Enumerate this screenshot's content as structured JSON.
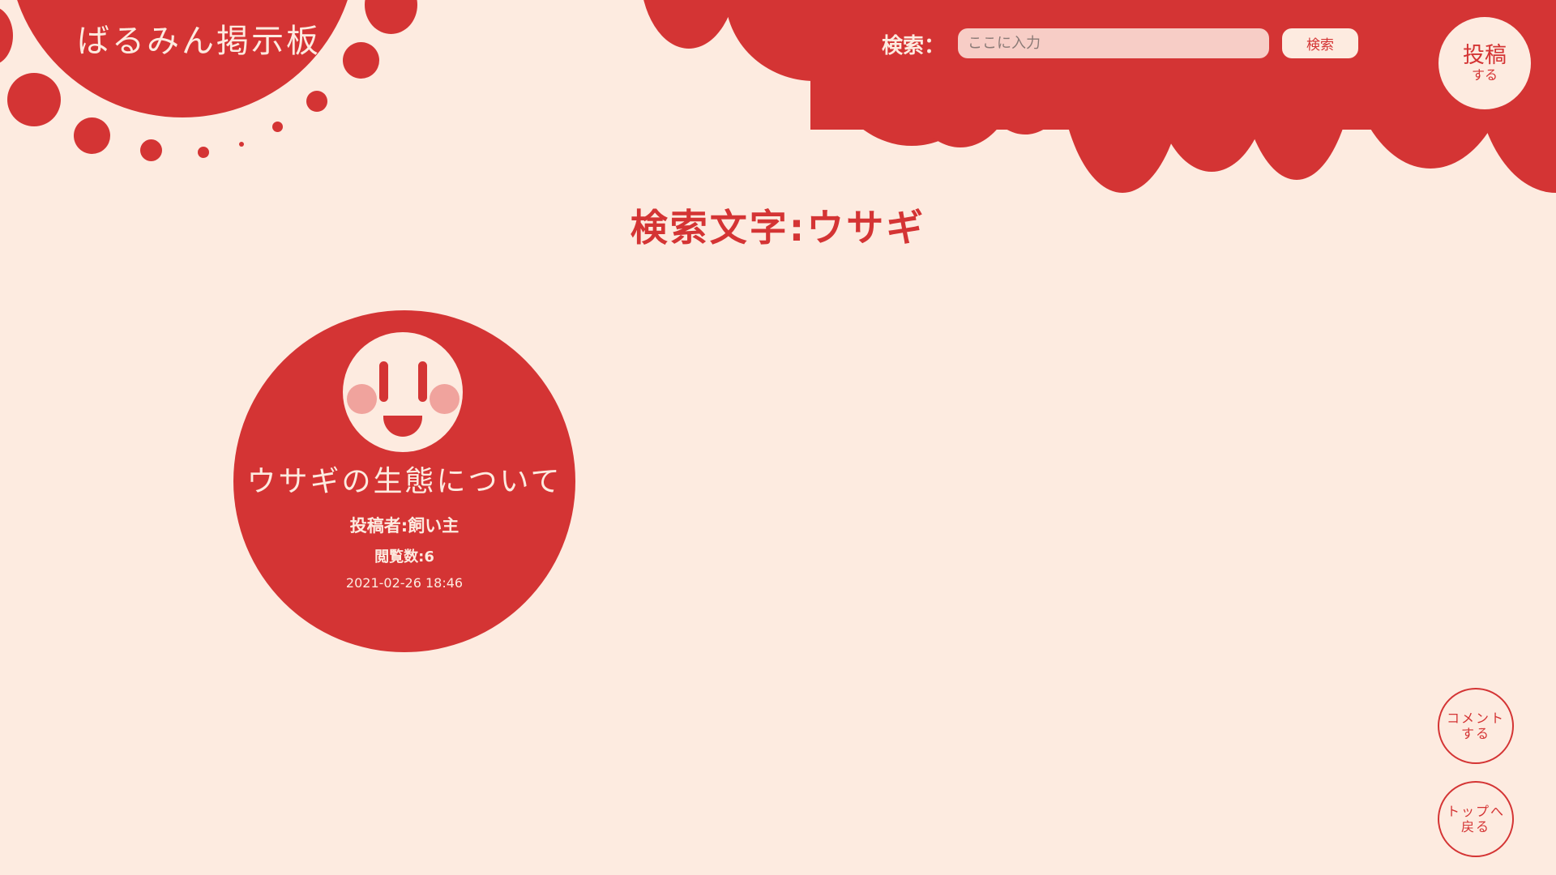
{
  "site": {
    "title": "ばるみん掲示板"
  },
  "header": {
    "search_label": "検索：",
    "search_placeholder": "ここに入力",
    "search_button": "検索",
    "post_button_main": "投稿",
    "post_button_sub": "する"
  },
  "main": {
    "title": "検索文字:ウサギ",
    "posts": [
      {
        "title": "ウサギの生態について",
        "author": "投稿者:飼い主",
        "views": "閲覧数:6",
        "date": "2021-02-26 18:46",
        "icon": "smiley-face-icon"
      }
    ]
  },
  "floating": {
    "comment_button": "コメント\nする",
    "top_button": "トップへ\n戻る"
  },
  "colors": {
    "background": "#fdebe0",
    "accent": "#d43434",
    "cheek": "#f0a39d",
    "input": "#f7cdc6"
  }
}
